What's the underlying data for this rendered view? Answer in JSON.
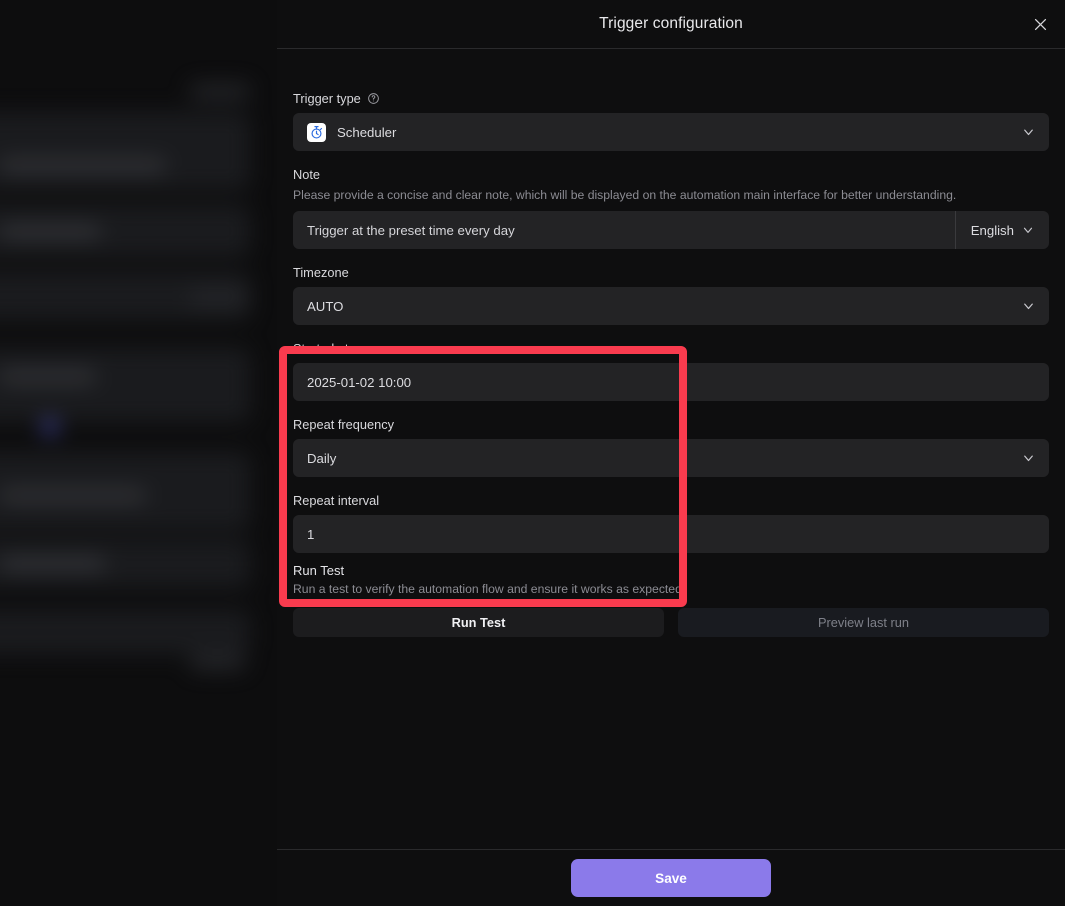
{
  "header": {
    "title": "Trigger configuration",
    "close_icon": "close-icon"
  },
  "form": {
    "trigger_type": {
      "label": "Trigger type",
      "help_icon": "question-circle-icon",
      "value": "Scheduler",
      "icon": "stopwatch-icon",
      "chevron_icon": "chevron-down-icon"
    },
    "note": {
      "label": "Note",
      "description": "Please provide a concise and clear note, which will be displayed on the automation main interface for better understanding.",
      "value": "Trigger at the preset time every day",
      "placeholder": "Trigger at the preset time every day",
      "language": "English",
      "chevron_icon": "chevron-down-icon"
    },
    "timezone": {
      "label": "Timezone",
      "value": "AUTO",
      "chevron_icon": "chevron-down-icon"
    },
    "started_at": {
      "label": "Started at",
      "value": "2025-01-02 10:00",
      "placeholder": "2025-01-02 10:00"
    },
    "repeat_frequency": {
      "label": "Repeat frequency",
      "value": "Daily",
      "chevron_icon": "chevron-down-icon"
    },
    "repeat_interval": {
      "label": "Repeat interval",
      "value": "1",
      "placeholder": "1"
    }
  },
  "run_test": {
    "title": "Run Test",
    "description": "Run a test to verify the automation flow and ensure it works as expected.",
    "run_button": "Run Test",
    "preview_button": "Preview last run"
  },
  "footer": {
    "save_label": "Save"
  },
  "colors": {
    "accent": "#8b7aea",
    "highlight": "#f93b4e",
    "modal_bg": "#0e0e0f",
    "field_bg": "#232325"
  }
}
